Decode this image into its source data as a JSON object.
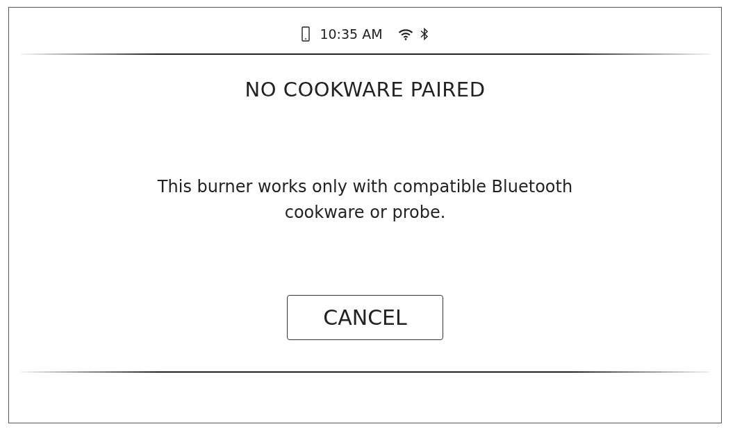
{
  "status_bar": {
    "time": "10:35 AM"
  },
  "title": "NO COOKWARE PAIRED",
  "message": "This burner works only with compatible Bluetooth cookware or probe.",
  "buttons": [
    "CANCEL"
  ]
}
